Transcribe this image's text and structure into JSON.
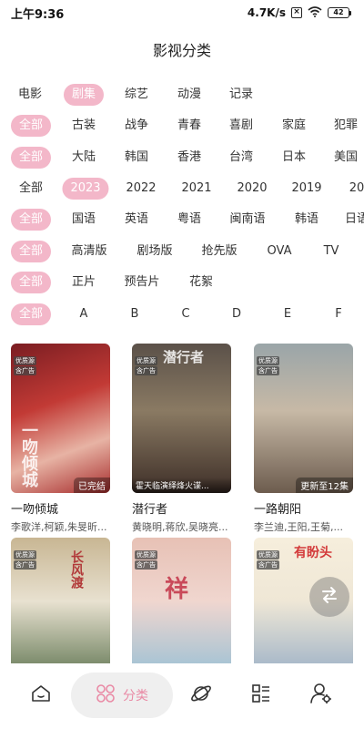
{
  "status_bar": {
    "time": "上午9:36",
    "speed": "4.7K/s",
    "battery": "42"
  },
  "title": "影视分类",
  "filters": {
    "type": [
      "电影",
      "剧集",
      "综艺",
      "动漫",
      "记录"
    ],
    "genre": [
      "全部",
      "古装",
      "战争",
      "青春",
      "喜剧",
      "家庭",
      "犯罪"
    ],
    "region": [
      "全部",
      "大陆",
      "韩国",
      "香港",
      "台湾",
      "日本",
      "美国"
    ],
    "year": [
      "全部",
      "2023",
      "2022",
      "2021",
      "2020",
      "2019",
      "20"
    ],
    "language": [
      "全部",
      "国语",
      "英语",
      "粤语",
      "闽南语",
      "韩语",
      "日语"
    ],
    "version": [
      "全部",
      "高清版",
      "剧场版",
      "抢先版",
      "OVA",
      "TV"
    ],
    "kind": [
      "全部",
      "正片",
      "预告片",
      "花絮"
    ],
    "letter": [
      "全部",
      "A",
      "B",
      "C",
      "D",
      "E",
      "F"
    ]
  },
  "cards": [
    {
      "title": "一吻倾城",
      "actors": "李歌洋,柯颖,朱旻昕...",
      "badge1": "优质源",
      "badge2": "含广告",
      "status": "已完结",
      "caption": "",
      "art": "一吻倾城"
    },
    {
      "title": "潜行者",
      "actors": "黄晓明,蒋欣,吴晓亮...",
      "badge1": "优质源",
      "badge2": "含广告",
      "status": "",
      "caption": "霍天临演绎烽火谍...",
      "art": "潜行者"
    },
    {
      "title": "一路朝阳",
      "actors": "李兰迪,王阳,王菊,...",
      "badge1": "优质源",
      "badge2": "含广告",
      "status": "更新至12集",
      "caption": "",
      "art": ""
    },
    {
      "title": "",
      "actors": "",
      "badge1": "优质源",
      "badge2": "含广告",
      "status": "",
      "caption": "",
      "art": "长风渡"
    },
    {
      "title": "",
      "actors": "",
      "badge1": "优质源",
      "badge2": "含广告",
      "status": "",
      "caption": "",
      "art": "祥"
    },
    {
      "title": "",
      "actors": "",
      "badge1": "优质源",
      "badge2": "含广告",
      "status": "",
      "caption": "",
      "art": "有盼头"
    }
  ],
  "nav": {
    "home_icon": "home-icon",
    "category_label": "分类",
    "discover_icon": "planet-icon",
    "list_icon": "list-icon",
    "user_icon": "user-settings-icon"
  },
  "colors": {
    "accent": "#f3b7c9",
    "accent_text": "#e98aa5"
  }
}
